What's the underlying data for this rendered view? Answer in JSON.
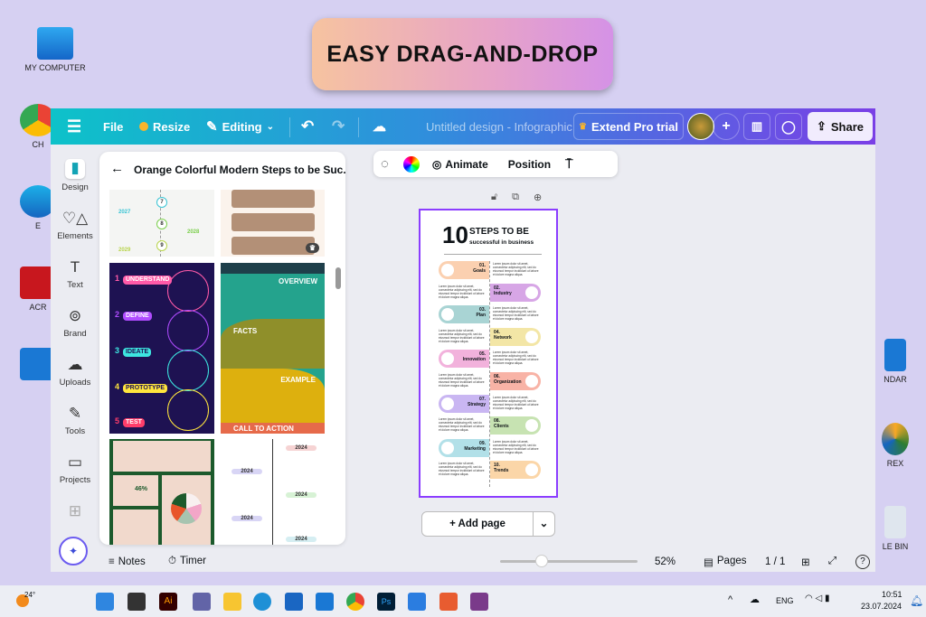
{
  "banner": "EASY DRAG-AND-DROP",
  "desktop": {
    "left": [
      "MY COMPUTER",
      "CH",
      "E",
      "ACR"
    ],
    "right": [
      "NDAR",
      "REX",
      "LE BIN"
    ]
  },
  "topbar": {
    "file": "File",
    "resize": "Resize",
    "editing": "Editing",
    "title": "Untitled design - Infographic",
    "extend": "Extend Pro trial",
    "share": "Share"
  },
  "rail": [
    "Design",
    "Elements",
    "Text",
    "Brand",
    "Uploads",
    "Tools",
    "Projects"
  ],
  "panel": {
    "title": "Orange Colorful Modern Steps to be Suc...",
    "tpl_a": [
      "7",
      "8",
      "9",
      "2027",
      "2028",
      "2029"
    ],
    "tpl_c": [
      "UNDERSTAND",
      "DEFINE",
      "IDEATE",
      "PROTOTYPE",
      "TEST"
    ],
    "tpl_d": [
      "OVERVIEW",
      "FACTS",
      "EXAMPLE",
      "CALL TO ACTION"
    ],
    "tpl_e": "46%",
    "tpl_f": [
      "2024",
      "2024",
      "2024",
      "2024",
      "2024"
    ]
  },
  "context": {
    "animate": "Animate",
    "position": "Position"
  },
  "design": {
    "big": "10",
    "title1": "STEPS TO BE",
    "title2": "successful in business",
    "lorem": "Lorem ipsum dolor sit amet, consectetur adipiscing elit, sed do eiusmod tempor incididunt ut labore et dolore magna aliqua.",
    "steps": [
      {
        "n": "01.",
        "t": "Goals",
        "c": "#fbd0b0"
      },
      {
        "n": "02.",
        "t": "Industry",
        "c": "#d7a6e6"
      },
      {
        "n": "03.",
        "t": "Plan",
        "c": "#a9d4d4"
      },
      {
        "n": "04.",
        "t": "Network",
        "c": "#f3e6a6"
      },
      {
        "n": "05.",
        "t": "Innovation",
        "c": "#f2b2dc"
      },
      {
        "n": "06.",
        "t": "Organization",
        "c": "#f8b3a6"
      },
      {
        "n": "07.",
        "t": "Strategy",
        "c": "#c9b6f2"
      },
      {
        "n": "08.",
        "t": "Clients",
        "c": "#c7e3b2"
      },
      {
        "n": "09.",
        "t": "Marketing",
        "c": "#b2e0e8"
      },
      {
        "n": "10.",
        "t": "Trends",
        "c": "#fbd6a8"
      }
    ]
  },
  "add_page": "+ Add page",
  "bottom": {
    "notes": "Notes",
    "timer": "Timer",
    "zoom": "52%",
    "pages": "Pages",
    "count": "1 / 1",
    "zoom_fraction": 0.3
  },
  "taskbar": {
    "temp": "24°",
    "lang": "ENG",
    "time": "10:51",
    "date": "23.07.2024"
  }
}
